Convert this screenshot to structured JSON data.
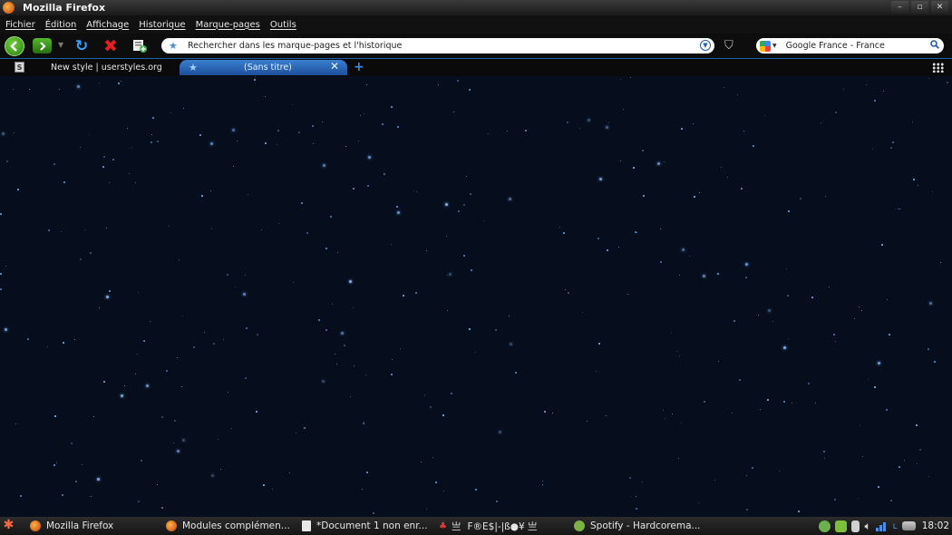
{
  "window": {
    "title": "Mozilla Firefox",
    "controls": [
      "–",
      "▫",
      "✕"
    ]
  },
  "menu": [
    "Fichier",
    "Édition",
    "Affichage",
    "Historique",
    "Marque-pages",
    "Outils"
  ],
  "navbar": {
    "url_placeholder": "Rechercher dans les marque-pages et l'historique",
    "search_engine": "Google France - France"
  },
  "tabs": [
    {
      "label": "New style | userstyles.org",
      "icon": "userstyles-icon",
      "active": false
    },
    {
      "label": "(Sans titre)",
      "icon": "star-icon",
      "active": true
    }
  ],
  "taskbar": {
    "tasks": [
      {
        "label": "Mozilla Firefox",
        "icon": "firefox-icon"
      },
      {
        "label": "Modules complémen...",
        "icon": "firefox-icon"
      },
      {
        "label": "*Document 1 non enr...",
        "icon": "document-icon"
      },
      {
        "label": "F®E$|-|ß●¥ 亗",
        "icon": "app-icon"
      },
      {
        "label": "Spotify - Hardcorema...",
        "icon": "spotify-icon"
      }
    ],
    "tray_prefix": "亗",
    "clock": "18:02"
  },
  "colors": {
    "content_bg": "#060d1c",
    "accent": "#1f5fa8",
    "star": "#7fb6ff"
  }
}
